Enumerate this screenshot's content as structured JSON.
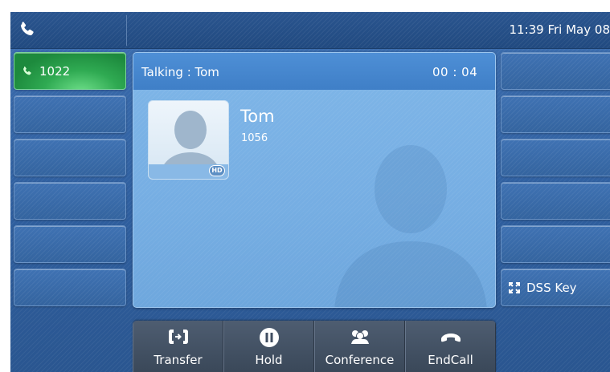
{
  "status_bar": {
    "clock": "11:39 Fri May 08"
  },
  "line_keys": [
    {
      "label": "1022",
      "active": true
    },
    {
      "label": ""
    },
    {
      "label": ""
    },
    {
      "label": ""
    },
    {
      "label": ""
    },
    {
      "label": ""
    }
  ],
  "call": {
    "status": "Talking : Tom",
    "timer": "00 : 04",
    "contact_name": "Tom",
    "contact_number": "1056",
    "hd_badge": "HD"
  },
  "dss_keys": [
    {
      "label": ""
    },
    {
      "label": ""
    },
    {
      "label": ""
    },
    {
      "label": ""
    },
    {
      "label": ""
    },
    {
      "label": "DSS Key"
    }
  ],
  "softkeys": [
    {
      "label": "Transfer",
      "icon": "transfer-icon"
    },
    {
      "label": "Hold",
      "icon": "hold-icon"
    },
    {
      "label": "Conference",
      "icon": "conference-icon"
    },
    {
      "label": "EndCall",
      "icon": "end-call-icon"
    }
  ],
  "colors": {
    "active_line": "#2faa52",
    "panel": "#7fb6e8",
    "header": "#4e8fd6",
    "softkey_bar": "#3a4859"
  }
}
